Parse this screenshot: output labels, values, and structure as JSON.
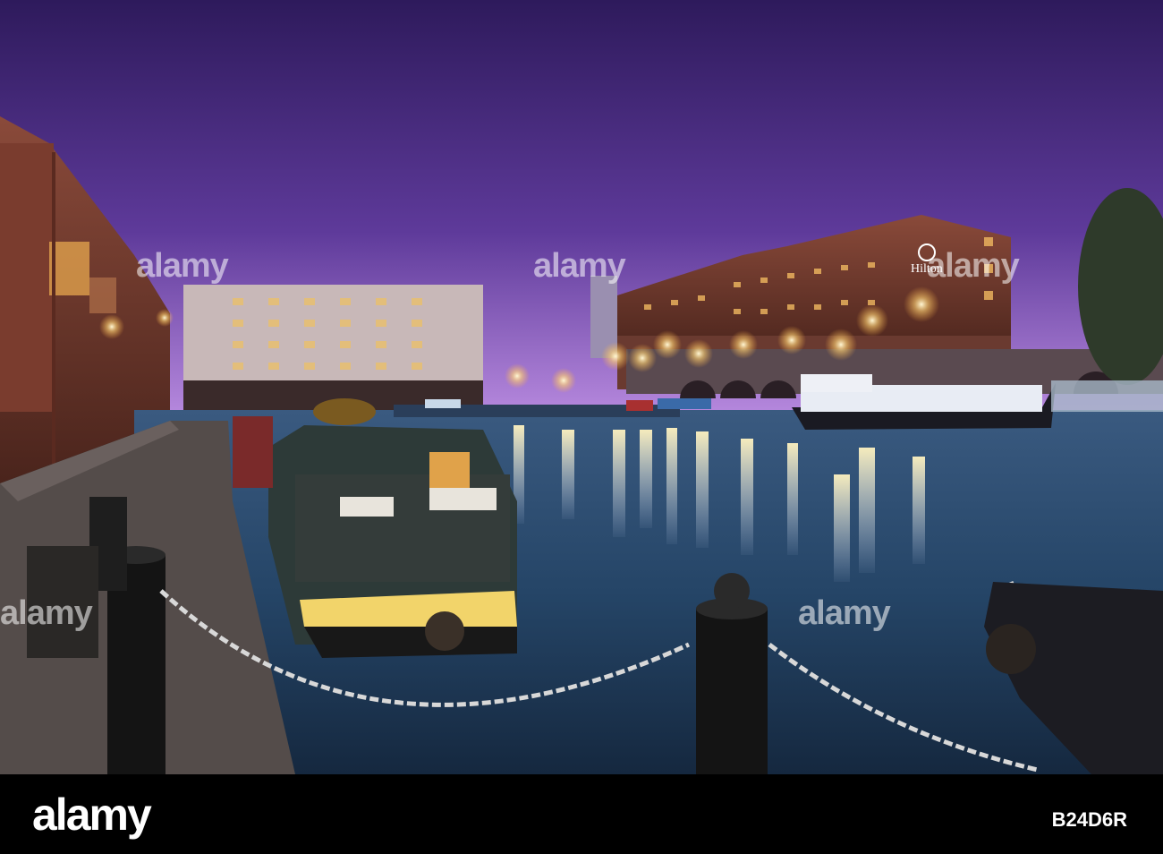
{
  "photo": {
    "hotel_sign": "Hilton"
  },
  "watermarks": [
    "alamy",
    "alamy",
    "alamy",
    "alamy",
    "alamy"
  ],
  "footer": {
    "brand": "alamy",
    "image_id": "B24D6R"
  },
  "colors": {
    "sky_top": "#3a1f6b",
    "sky_bottom": "#b07bd9",
    "water": "#1d3a55",
    "footer_bg": "#000000"
  }
}
